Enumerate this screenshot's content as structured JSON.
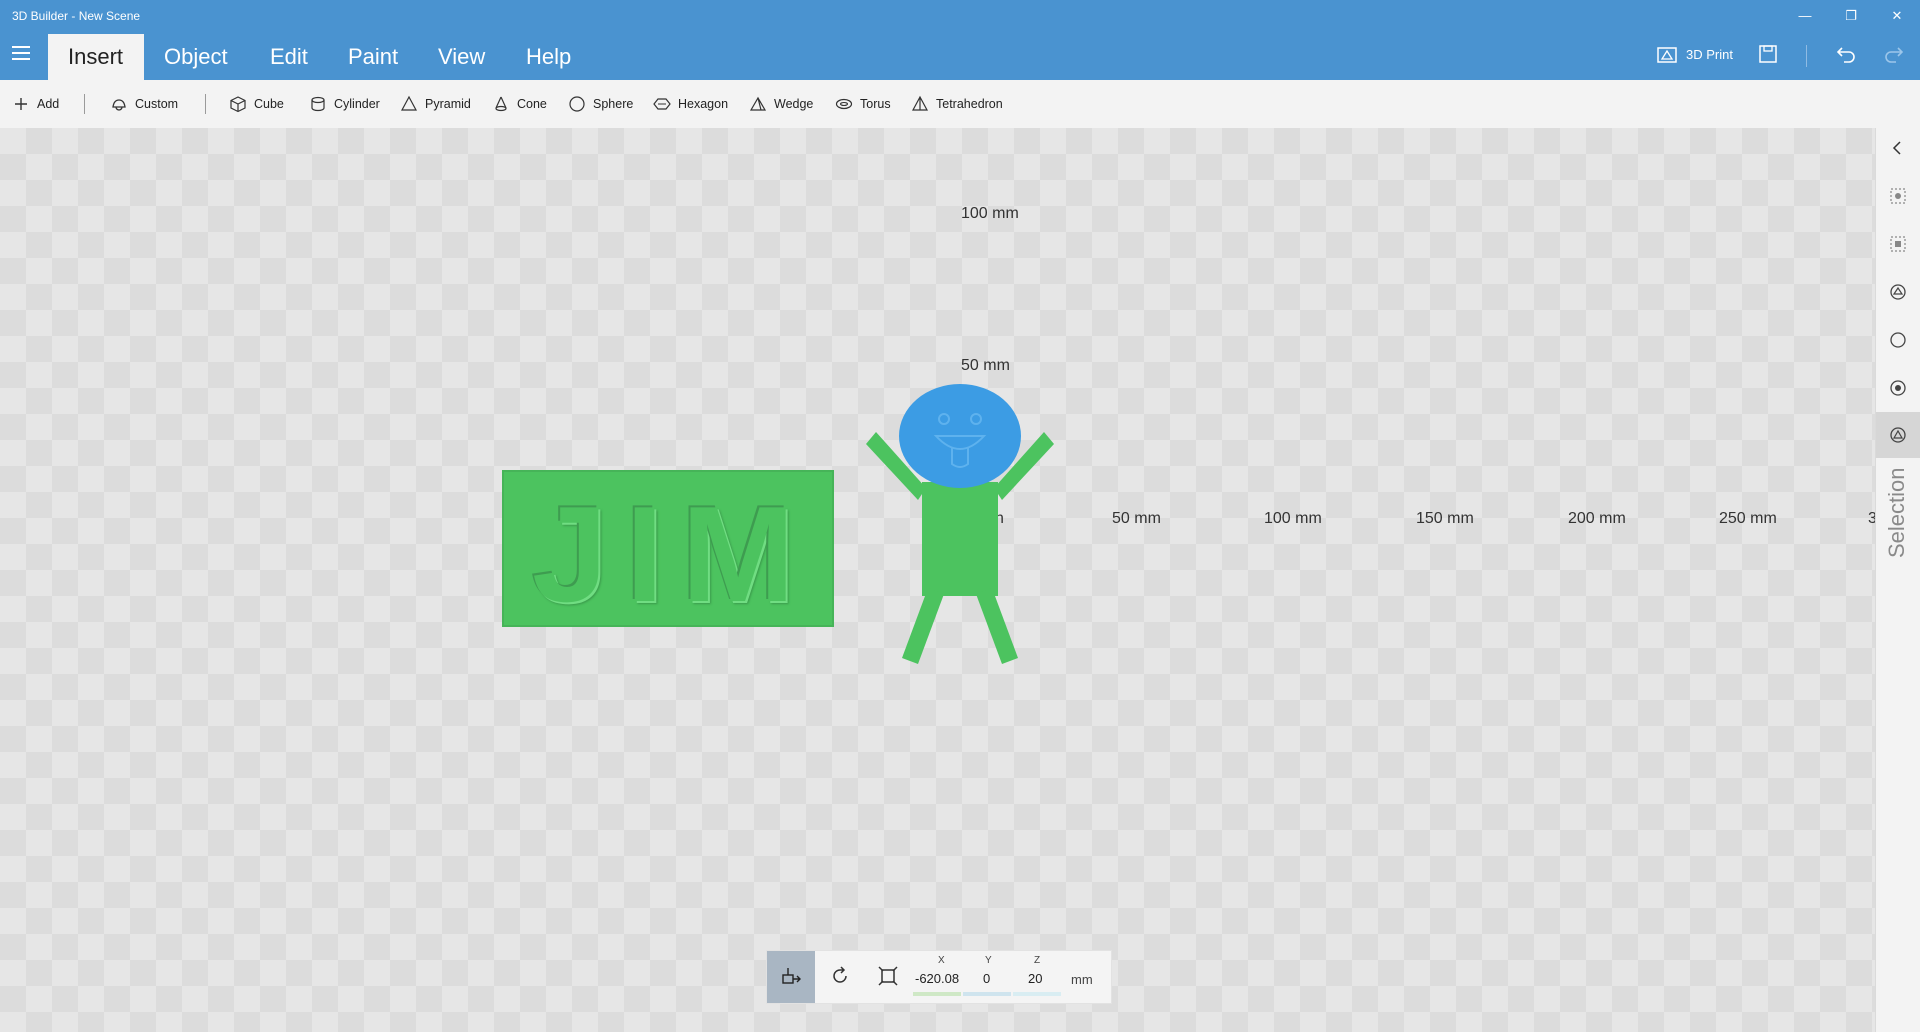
{
  "window": {
    "title": "3D Builder - New Scene",
    "minimize": "—",
    "restore": "❐",
    "close": "✕"
  },
  "menu": {
    "tabs": [
      {
        "label": "Insert",
        "active": true
      },
      {
        "label": "Object",
        "active": false
      },
      {
        "label": "Edit",
        "active": false
      },
      {
        "label": "Paint",
        "active": false
      },
      {
        "label": "View",
        "active": false
      },
      {
        "label": "Help",
        "active": false
      }
    ],
    "print_label": "3D Print"
  },
  "toolbar": {
    "add": "Add",
    "custom": "Custom",
    "cube": "Cube",
    "cylinder": "Cylinder",
    "pyramid": "Pyramid",
    "cone": "Cone",
    "sphere": "Sphere",
    "hexagon": "Hexagon",
    "wedge": "Wedge",
    "torus": "Torus",
    "tetrahedron": "Tetrahedron"
  },
  "viewport": {
    "ruler_v": [
      "100 mm",
      "50 mm"
    ],
    "ruler_h": [
      "n",
      "50 mm",
      "100 mm",
      "150 mm",
      "200 mm",
      "250 mm",
      "3"
    ],
    "text_object": "JIM",
    "colors": {
      "green": "#4cc35f",
      "blue": "#3c9ce4"
    }
  },
  "right_panel": {
    "selection_label": "Selection"
  },
  "transform": {
    "x_label": "X",
    "x_value": "-620.08",
    "y_label": "Y",
    "y_value": "0",
    "z_label": "Z",
    "z_value": "20",
    "unit": "mm"
  }
}
